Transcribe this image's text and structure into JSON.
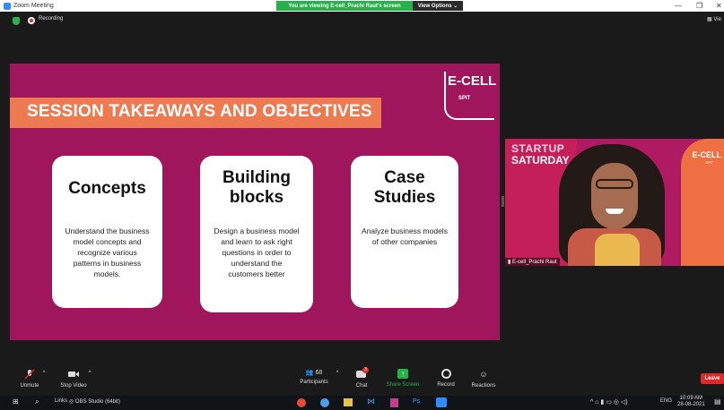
{
  "window": {
    "title": "Zoom Meeting",
    "share_banner": "You are viewing E-cell_Prachi Raut's screen",
    "view_options": "View Options ⌄"
  },
  "topbar": {
    "recording_label": "Recording",
    "view_label": "Vie"
  },
  "slide": {
    "title": "SESSION TAKEAWAYS AND OBJECTIVES",
    "logo_text": "E-CELL",
    "logo_sub": "SPIT",
    "cards": [
      {
        "title_lines": [
          "Concepts"
        ],
        "body_lines": [
          "Understand the business",
          "model concepts and",
          "recognize various",
          "patterns in business",
          "models."
        ]
      },
      {
        "title_lines": [
          "Building",
          "blocks"
        ],
        "body_lines": [
          "Design a business model",
          "and learn to ask right",
          "questions in order to",
          "understand the",
          "customers better"
        ]
      },
      {
        "title_lines": [
          "Case",
          "Studies"
        ],
        "body_lines": [
          "Analyze business models",
          "of other companies"
        ]
      }
    ]
  },
  "camera": {
    "startup": "STARTUP",
    "saturday": "SATURDAY",
    "ecell": "E-CELL",
    "ecell_sub": "SPIT",
    "participant_name": "E-cell_Prachi Raut"
  },
  "toolbar": {
    "unmute": "Unmute",
    "stop_video": "Stop Video",
    "participants": "Participants",
    "participants_count": "68",
    "chat": "Chat",
    "chat_badge": "3",
    "share_screen": "Share Screen",
    "record": "Record",
    "reactions": "Reactions",
    "leave": "Leave",
    "accent": "#25b24a"
  },
  "taskbar": {
    "links": "Links",
    "obs": "OBS Studio (64bit)",
    "language": "ENG",
    "time": "10:09 AM",
    "date": "28-08-2021"
  }
}
